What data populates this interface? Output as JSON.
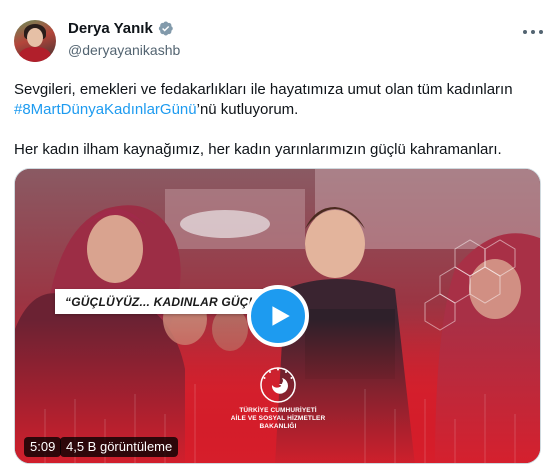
{
  "author": {
    "display_name": "Derya Yanık",
    "handle": "@deryayanikashb",
    "verified_icon": "verified-badge-icon",
    "more_icon": "more-options-icon"
  },
  "tweet": {
    "line1_before": "Sevgileri, emekleri ve fedakarlıkları ile hayatımıza umut olan tüm kadınların ",
    "hashtag": "#8MartDünyaKadınlarGünü",
    "line1_after": "’nü kutluyorum.",
    "line2": "Her kadın ilham kaynağımız, her kadın yarınlarımızın güçlü kahramanları."
  },
  "video": {
    "slogan": "“GÜÇLÜYÜZ... KADINLAR GÜÇLÜ!”",
    "ministry_lines": [
      "TÜRKİYE CUMHURİYETİ",
      "AİLE VE SOSYAL HİZMETLER",
      "BAKANLIĞI"
    ],
    "duration": "5:09",
    "views": "4,5 B görüntüleme",
    "play_icon": "play-icon",
    "emblem_icon": "ministry-emblem-icon"
  },
  "colors": {
    "accent": "#1d9bf0",
    "text_primary": "#0f1419",
    "text_secondary": "#536471",
    "video_red": "#d81f2c"
  }
}
